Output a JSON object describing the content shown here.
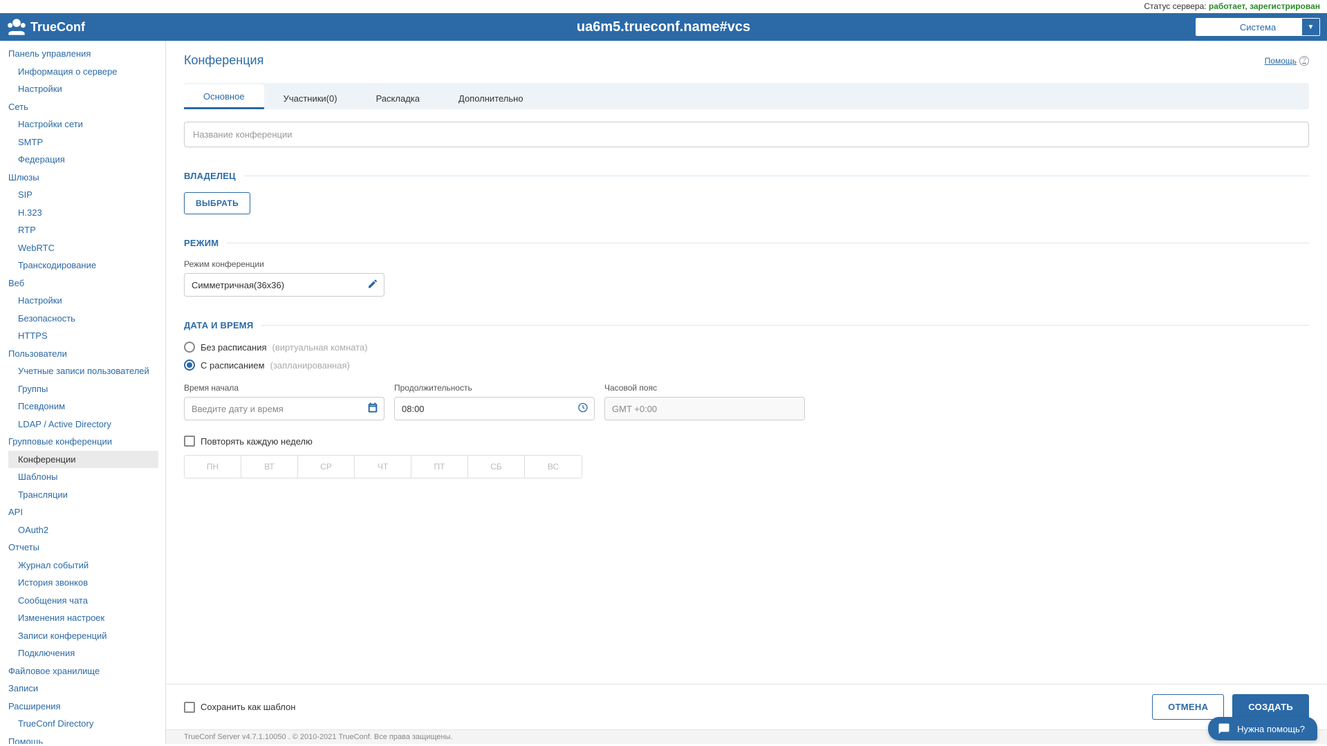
{
  "status": {
    "label": "Статус сервера: ",
    "value": "работает, зарегистрирован"
  },
  "brand": "TrueConf",
  "server_name": "ua6m5.trueconf.name#vcs",
  "system_select": "Система",
  "sidebar": {
    "s0": {
      "t": "Панель управления",
      "c0": "Информация о сервере",
      "c1": "Настройки"
    },
    "s1": {
      "t": "Сеть",
      "c0": "Настройки сети",
      "c1": "SMTP",
      "c2": "Федерация"
    },
    "s2": {
      "t": "Шлюзы",
      "c0": "SIP",
      "c1": "H.323",
      "c2": "RTP",
      "c3": "WebRTC",
      "c4": "Транскодирование"
    },
    "s3": {
      "t": "Веб",
      "c0": "Настройки",
      "c1": "Безопасность",
      "c2": "HTTPS"
    },
    "s4": {
      "t": "Пользователи",
      "c0": "Учетные записи пользователей",
      "c1": "Группы",
      "c2": "Псевдоним",
      "c3": "LDAP / Active Directory"
    },
    "s5": {
      "t": "Групповые конференции",
      "c0": "Конференции",
      "c1": "Шаблоны",
      "c2": "Трансляции"
    },
    "s6": {
      "t": "API",
      "c0": "OAuth2"
    },
    "s7": {
      "t": "Отчеты",
      "c0": "Журнал событий",
      "c1": "История звонков",
      "c2": "Сообщения чата",
      "c3": "Изменения настроек",
      "c4": "Записи конференций",
      "c5": "Подключения"
    },
    "s8": {
      "t": "Файловое хранилище"
    },
    "s9": {
      "t": "Записи"
    },
    "s10": {
      "t": "Расширения",
      "c0": "TrueConf Directory"
    },
    "s11": {
      "t": "Помощь"
    }
  },
  "page": {
    "title": "Конференция",
    "help": "Помощь"
  },
  "tabs": {
    "t0": "Основное",
    "t1": "Участники(0)",
    "t2": "Раскладка",
    "t3": "Дополнительно"
  },
  "form": {
    "name_placeholder": "Название конференции",
    "owner_heading": "ВЛАДЕЛЕЦ",
    "choose_btn": "ВЫБРАТЬ",
    "mode_heading": "РЕЖИМ",
    "mode_label": "Режим конференции",
    "mode_value": "Симметричная(36x36)",
    "dt_heading": "ДАТА И ВРЕМЯ",
    "no_schedule": "Без расписания",
    "no_schedule_hint": "(виртуальная комната)",
    "with_schedule": "С расписанием",
    "with_schedule_hint": "(запланированная)",
    "start_label": "Время начала",
    "start_placeholder": "Введите дату и время",
    "duration_label": "Продолжительность",
    "duration_value": "08:00",
    "tz_label": "Часовой пояс",
    "tz_value": "GMT +0:00",
    "repeat_label": "Повторять каждую неделю",
    "days": {
      "d0": "ПН",
      "d1": "ВТ",
      "d2": "СР",
      "d3": "ЧТ",
      "d4": "ПТ",
      "d5": "СБ",
      "d6": "ВС"
    },
    "save_template": "Сохранить как шаблон",
    "cancel": "ОТМЕНА",
    "create": "СОЗДАТЬ"
  },
  "footer": "TrueConf Server v4.7.1.10050 . © 2010-2021 TrueConf. Все права защищены.",
  "help_bubble": "Нужна помощь?"
}
